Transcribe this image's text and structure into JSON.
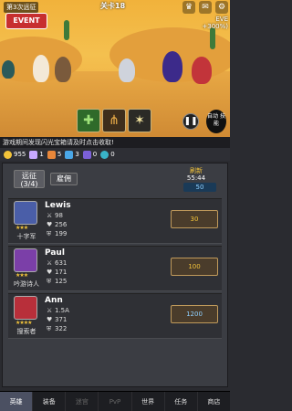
{
  "scene": {
    "expedition_label": "第3次远征",
    "stage": "关卡18",
    "event_button": "EVENT",
    "bonus_line1": "EVE",
    "bonus_line2": "+300%)",
    "pause_label": "❚❚",
    "auto_label": "自动\n技能"
  },
  "notice": "游戏期间发现闪光宝箱请及时点击收取!",
  "resources": {
    "gold": "955",
    "a": "1",
    "b": "5",
    "c": "3",
    "d": "0",
    "e": "0"
  },
  "panel": {
    "tab_expedition": "远征\n(3/4)",
    "tab_camp": "雇佣",
    "refresh_label": "刷新",
    "refresh_time": "55:44",
    "refresh_cost": "50"
  },
  "heroes": [
    {
      "name": "Lewis",
      "class": "十字军",
      "stars": "★★★",
      "attack": "98",
      "hp": "256",
      "def": "199",
      "price": "30",
      "currency": "gold"
    },
    {
      "name": "Paul",
      "class": "吟游诗人",
      "stars": "★★★",
      "attack": "631",
      "hp": "171",
      "def": "125",
      "price": "100",
      "currency": "gold"
    },
    {
      "name": "Ann",
      "class": "搜索者",
      "stars": "★★★★",
      "attack": "1.5A",
      "hp": "371",
      "def": "322",
      "price": "1200",
      "currency": "gem"
    }
  ],
  "nav": [
    {
      "label": "英雄",
      "active": true
    },
    {
      "label": "装备"
    },
    {
      "label": "迷宫"
    },
    {
      "label": "PvP"
    },
    {
      "label": "世界"
    },
    {
      "label": "任务"
    },
    {
      "label": "商店"
    }
  ],
  "colors": {
    "sand": "#f1b23b",
    "panel": "#3b3d43",
    "gold": "#f2c33a",
    "active_tab": "#4b5062"
  }
}
